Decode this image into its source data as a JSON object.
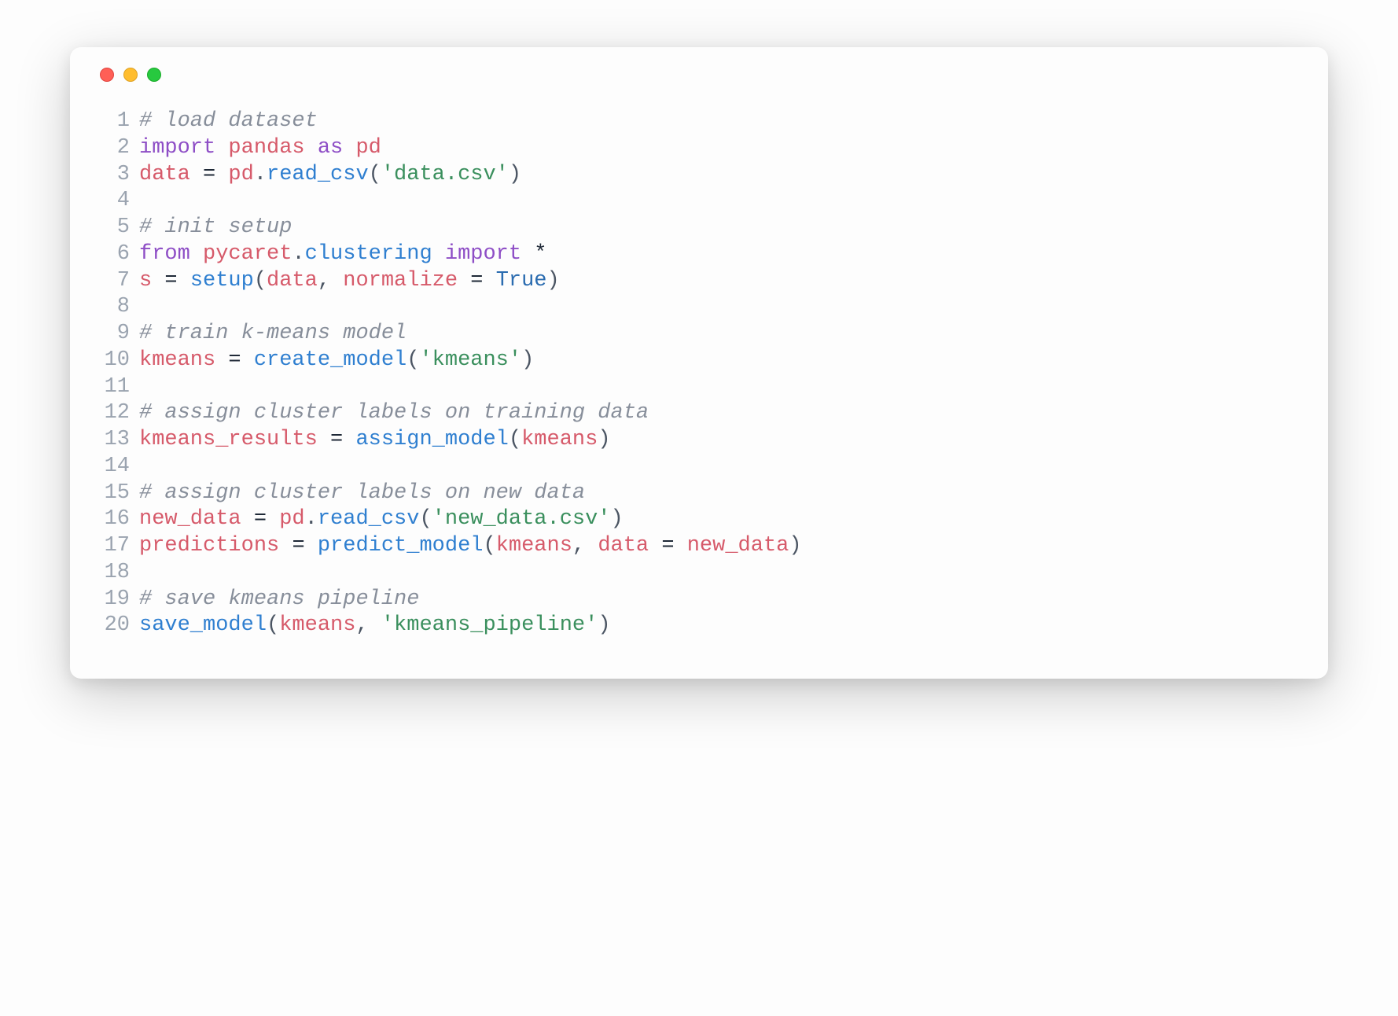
{
  "window": {
    "traffic_lights": [
      "close",
      "minimize",
      "zoom"
    ]
  },
  "code": {
    "lines": [
      {
        "num": "1",
        "tokens": [
          {
            "cls": "tok-comment",
            "text": "# load dataset"
          }
        ]
      },
      {
        "num": "2",
        "tokens": [
          {
            "cls": "tok-kw",
            "text": "import"
          },
          {
            "cls": "tok-plain",
            "text": " "
          },
          {
            "cls": "tok-var",
            "text": "pandas"
          },
          {
            "cls": "tok-plain",
            "text": " "
          },
          {
            "cls": "tok-kw",
            "text": "as"
          },
          {
            "cls": "tok-plain",
            "text": " "
          },
          {
            "cls": "tok-var",
            "text": "pd"
          }
        ]
      },
      {
        "num": "3",
        "tokens": [
          {
            "cls": "tok-var",
            "text": "data"
          },
          {
            "cls": "tok-plain",
            "text": " "
          },
          {
            "cls": "tok-op",
            "text": "="
          },
          {
            "cls": "tok-plain",
            "text": " "
          },
          {
            "cls": "tok-var",
            "text": "pd"
          },
          {
            "cls": "tok-punct",
            "text": "."
          },
          {
            "cls": "tok-func",
            "text": "read_csv"
          },
          {
            "cls": "tok-punct",
            "text": "("
          },
          {
            "cls": "tok-str",
            "text": "'data.csv'"
          },
          {
            "cls": "tok-punct",
            "text": ")"
          }
        ]
      },
      {
        "num": "4",
        "tokens": []
      },
      {
        "num": "5",
        "tokens": [
          {
            "cls": "tok-comment",
            "text": "# init setup"
          }
        ]
      },
      {
        "num": "6",
        "tokens": [
          {
            "cls": "tok-kw",
            "text": "from"
          },
          {
            "cls": "tok-plain",
            "text": " "
          },
          {
            "cls": "tok-var",
            "text": "pycaret"
          },
          {
            "cls": "tok-punct",
            "text": "."
          },
          {
            "cls": "tok-func",
            "text": "clustering"
          },
          {
            "cls": "tok-plain",
            "text": " "
          },
          {
            "cls": "tok-kw",
            "text": "import"
          },
          {
            "cls": "tok-plain",
            "text": " "
          },
          {
            "cls": "tok-op",
            "text": "*"
          }
        ]
      },
      {
        "num": "7",
        "tokens": [
          {
            "cls": "tok-var",
            "text": "s"
          },
          {
            "cls": "tok-plain",
            "text": " "
          },
          {
            "cls": "tok-op",
            "text": "="
          },
          {
            "cls": "tok-plain",
            "text": " "
          },
          {
            "cls": "tok-func",
            "text": "setup"
          },
          {
            "cls": "tok-punct",
            "text": "("
          },
          {
            "cls": "tok-var",
            "text": "data"
          },
          {
            "cls": "tok-punct",
            "text": ","
          },
          {
            "cls": "tok-plain",
            "text": " "
          },
          {
            "cls": "tok-var",
            "text": "normalize"
          },
          {
            "cls": "tok-plain",
            "text": " "
          },
          {
            "cls": "tok-op",
            "text": "="
          },
          {
            "cls": "tok-plain",
            "text": " "
          },
          {
            "cls": "tok-const",
            "text": "True"
          },
          {
            "cls": "tok-punct",
            "text": ")"
          }
        ]
      },
      {
        "num": "8",
        "tokens": []
      },
      {
        "num": "9",
        "tokens": [
          {
            "cls": "tok-comment",
            "text": "# train k-means model"
          }
        ]
      },
      {
        "num": "10",
        "tokens": [
          {
            "cls": "tok-var",
            "text": "kmeans"
          },
          {
            "cls": "tok-plain",
            "text": " "
          },
          {
            "cls": "tok-op",
            "text": "="
          },
          {
            "cls": "tok-plain",
            "text": " "
          },
          {
            "cls": "tok-func",
            "text": "create_model"
          },
          {
            "cls": "tok-punct",
            "text": "("
          },
          {
            "cls": "tok-str",
            "text": "'kmeans'"
          },
          {
            "cls": "tok-punct",
            "text": ")"
          }
        ]
      },
      {
        "num": "11",
        "tokens": []
      },
      {
        "num": "12",
        "tokens": [
          {
            "cls": "tok-comment",
            "text": "# assign cluster labels on training data"
          }
        ]
      },
      {
        "num": "13",
        "tokens": [
          {
            "cls": "tok-var",
            "text": "kmeans_results"
          },
          {
            "cls": "tok-plain",
            "text": " "
          },
          {
            "cls": "tok-op",
            "text": "="
          },
          {
            "cls": "tok-plain",
            "text": " "
          },
          {
            "cls": "tok-func",
            "text": "assign_model"
          },
          {
            "cls": "tok-punct",
            "text": "("
          },
          {
            "cls": "tok-var",
            "text": "kmeans"
          },
          {
            "cls": "tok-punct",
            "text": ")"
          }
        ]
      },
      {
        "num": "14",
        "tokens": []
      },
      {
        "num": "15",
        "tokens": [
          {
            "cls": "tok-comment",
            "text": "# assign cluster labels on new data"
          }
        ]
      },
      {
        "num": "16",
        "tokens": [
          {
            "cls": "tok-var",
            "text": "new_data"
          },
          {
            "cls": "tok-plain",
            "text": " "
          },
          {
            "cls": "tok-op",
            "text": "="
          },
          {
            "cls": "tok-plain",
            "text": " "
          },
          {
            "cls": "tok-var",
            "text": "pd"
          },
          {
            "cls": "tok-punct",
            "text": "."
          },
          {
            "cls": "tok-func",
            "text": "read_csv"
          },
          {
            "cls": "tok-punct",
            "text": "("
          },
          {
            "cls": "tok-str",
            "text": "'new_data.csv'"
          },
          {
            "cls": "tok-punct",
            "text": ")"
          }
        ]
      },
      {
        "num": "17",
        "tokens": [
          {
            "cls": "tok-var",
            "text": "predictions"
          },
          {
            "cls": "tok-plain",
            "text": " "
          },
          {
            "cls": "tok-op",
            "text": "="
          },
          {
            "cls": "tok-plain",
            "text": " "
          },
          {
            "cls": "tok-func",
            "text": "predict_model"
          },
          {
            "cls": "tok-punct",
            "text": "("
          },
          {
            "cls": "tok-var",
            "text": "kmeans"
          },
          {
            "cls": "tok-punct",
            "text": ","
          },
          {
            "cls": "tok-plain",
            "text": " "
          },
          {
            "cls": "tok-var",
            "text": "data"
          },
          {
            "cls": "tok-plain",
            "text": " "
          },
          {
            "cls": "tok-op",
            "text": "="
          },
          {
            "cls": "tok-plain",
            "text": " "
          },
          {
            "cls": "tok-var",
            "text": "new_data"
          },
          {
            "cls": "tok-punct",
            "text": ")"
          }
        ]
      },
      {
        "num": "18",
        "tokens": []
      },
      {
        "num": "19",
        "tokens": [
          {
            "cls": "tok-comment",
            "text": "# save kmeans pipeline"
          }
        ]
      },
      {
        "num": "20",
        "tokens": [
          {
            "cls": "tok-func",
            "text": "save_model"
          },
          {
            "cls": "tok-punct",
            "text": "("
          },
          {
            "cls": "tok-var",
            "text": "kmeans"
          },
          {
            "cls": "tok-punct",
            "text": ","
          },
          {
            "cls": "tok-plain",
            "text": " "
          },
          {
            "cls": "tok-str",
            "text": "'kmeans_pipeline'"
          },
          {
            "cls": "tok-punct",
            "text": ")"
          }
        ]
      }
    ]
  }
}
